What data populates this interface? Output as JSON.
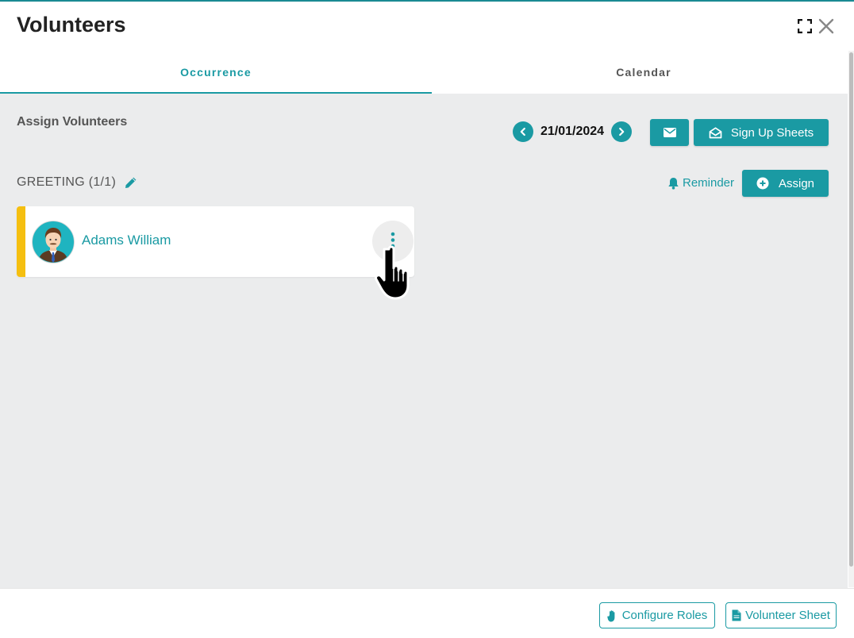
{
  "modal": {
    "title": "Volunteers"
  },
  "tabs": [
    {
      "label": "Occurrence",
      "active": true
    },
    {
      "label": "Calendar",
      "active": false
    }
  ],
  "assign": {
    "section_title": "Assign Volunteers",
    "date": "21/01/2024",
    "signup_label": "Sign Up Sheets"
  },
  "role": {
    "title": "GREETING (1/1)",
    "reminder_label": "Reminder",
    "assign_label": "Assign",
    "volunteers": [
      {
        "name": "Adams William"
      }
    ]
  },
  "footer": {
    "configure_roles_label": "Configure Roles",
    "volunteer_sheet_label": "Volunteer Sheet"
  },
  "colors": {
    "accent": "#1a9aa3",
    "role_bar": "#f5bf10",
    "background": "#ebeced"
  },
  "icons": [
    "expand-icon",
    "close-icon",
    "chevron-left-icon",
    "chevron-right-icon",
    "envelope-icon",
    "envelope-open-icon",
    "pencil-icon",
    "bell-icon",
    "plus-circle-icon",
    "more-vertical-icon",
    "hand-icon",
    "document-icon"
  ]
}
